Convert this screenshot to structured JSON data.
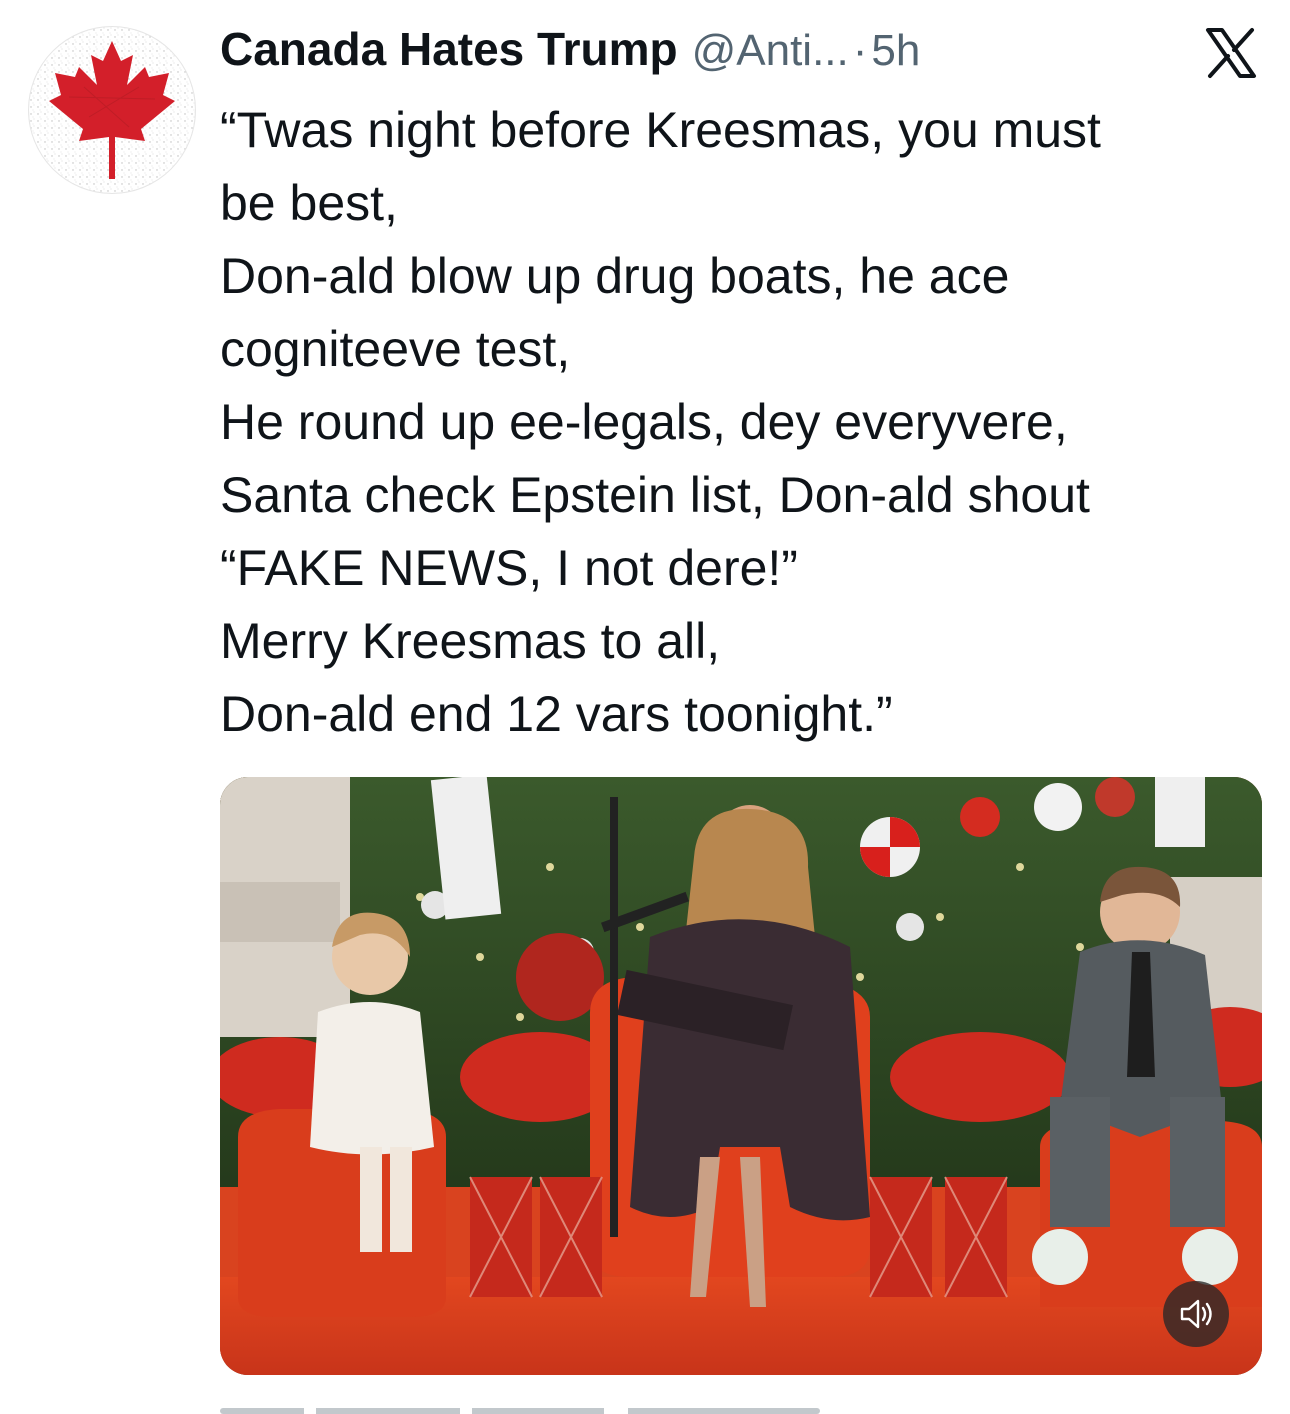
{
  "tweet": {
    "author_name": "Canada Hates Trump",
    "author_handle": "@Anti...",
    "separator": "·",
    "time": "5h",
    "text_lines": [
      "“Twas night before Kreesmas, you must",
      "be best,",
      "Don-ald blow up drug boats, he ace",
      "cogniteeve test,",
      "He round up ee-legals, dey everyvere,",
      "Santa check Epstein list, Don-ald shout",
      "“FAKE NEWS, I not dere!”",
      "Merry Kreesmas to all,",
      "Don-ald end 12 vars toonight.”"
    ]
  },
  "icons": {
    "avatar": "maple-leaf-icon",
    "platform": "x-logo-icon",
    "media_control": "speaker-icon"
  },
  "colors": {
    "text": "#0f1419",
    "secondary": "#536471",
    "maple_red": "#d31f2a",
    "media_red": "#d8381c"
  }
}
